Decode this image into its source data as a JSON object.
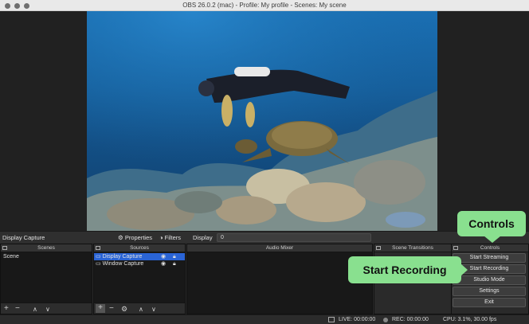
{
  "window": {
    "title": "OBS 26.0.2 (mac) - Profile: My profile - Scenes: My scene"
  },
  "context_bar": {
    "source_name": "Display Capture",
    "properties_label": "Properties",
    "filters_label": "Filters",
    "display_label": "Display",
    "display_value": "0"
  },
  "docks": {
    "scenes": {
      "title": "Scenes",
      "items": [
        "Scene"
      ]
    },
    "sources": {
      "title": "Sources",
      "items": [
        "Display Capture",
        "Window Capture"
      ]
    },
    "audio_mixer": {
      "title": "Audio Mixer"
    },
    "scene_transitions": {
      "title": "Scene Transitions"
    },
    "controls": {
      "title": "Controls",
      "buttons": [
        "Start Streaming",
        "Start Recording",
        "Studio Mode",
        "Settings",
        "Exit"
      ]
    }
  },
  "status": {
    "live": "LIVE: 00:00:00",
    "rec": "REC: 00:00:00",
    "cpu": "CPU: 3.1%, 30.00 fps"
  },
  "callouts": {
    "controls": "Controls",
    "start_recording": "Start Recording"
  },
  "colors": {
    "accent": "#2a64d6",
    "callout": "#89e08f"
  }
}
